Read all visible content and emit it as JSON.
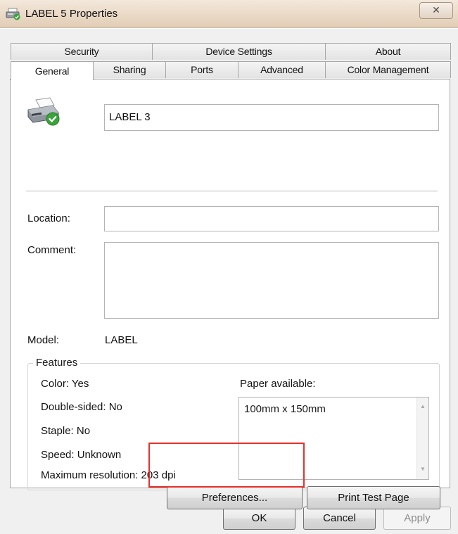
{
  "window": {
    "title": "LABEL 5 Properties",
    "close_glyph": "✕"
  },
  "tabs": {
    "row_back": [
      "Security",
      "Device Settings",
      "About"
    ],
    "row_front": [
      "General",
      "Sharing",
      "Ports",
      "Advanced",
      "Color Management"
    ],
    "active": "General"
  },
  "general": {
    "printer_name": "LABEL 3",
    "location_label": "Location:",
    "location_value": "",
    "comment_label": "Comment:",
    "comment_value": "",
    "model_label": "Model:",
    "model_value": "LABEL"
  },
  "features": {
    "title": "Features",
    "color": "Color: Yes",
    "double_sided": "Double-sided: No",
    "staple": "Staple: No",
    "speed": "Speed: Unknown",
    "max_resolution": "Maximum resolution: 203 dpi",
    "paper_label": "Paper available:",
    "paper_options": [
      "100mm x 150mm"
    ]
  },
  "buttons": {
    "preferences": "Preferences...",
    "print_test_page": "Print Test Page",
    "ok": "OK",
    "cancel": "Cancel",
    "apply": "Apply"
  },
  "icons": {
    "title_icon": "printer-icon",
    "printer_icon": "printer-ready-icon",
    "close_icon": "close-icon"
  },
  "colors": {
    "highlight": "#e8312b",
    "check_green": "#3aa33a"
  }
}
